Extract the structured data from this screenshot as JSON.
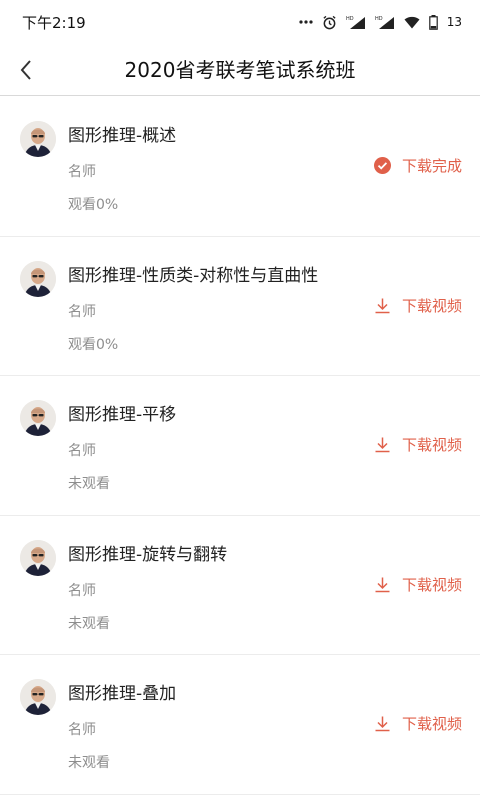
{
  "status_bar": {
    "time": "下午2:19",
    "battery": "13"
  },
  "nav": {
    "title": "2020省考联考笔试系统班"
  },
  "lessons": [
    {
      "title": "图形推理-概述",
      "teacher": "名师",
      "progress": "观看0%",
      "action": "下载完成",
      "action_icon": "check-circle-icon"
    },
    {
      "title": "图形推理-性质类-对称性与直曲性",
      "teacher": "名师",
      "progress": "观看0%",
      "action": "下载视频",
      "action_icon": "download-icon"
    },
    {
      "title": "图形推理-平移",
      "teacher": "名师",
      "progress": "未观看",
      "action": "下载视频",
      "action_icon": "download-icon"
    },
    {
      "title": "图形推理-旋转与翻转",
      "teacher": "名师",
      "progress": "未观看",
      "action": "下载视频",
      "action_icon": "download-icon"
    },
    {
      "title": "图形推理-叠加",
      "teacher": "名师",
      "progress": "未观看",
      "action": "下载视频",
      "action_icon": "download-icon"
    }
  ],
  "colors": {
    "accent": "#e0604a"
  }
}
